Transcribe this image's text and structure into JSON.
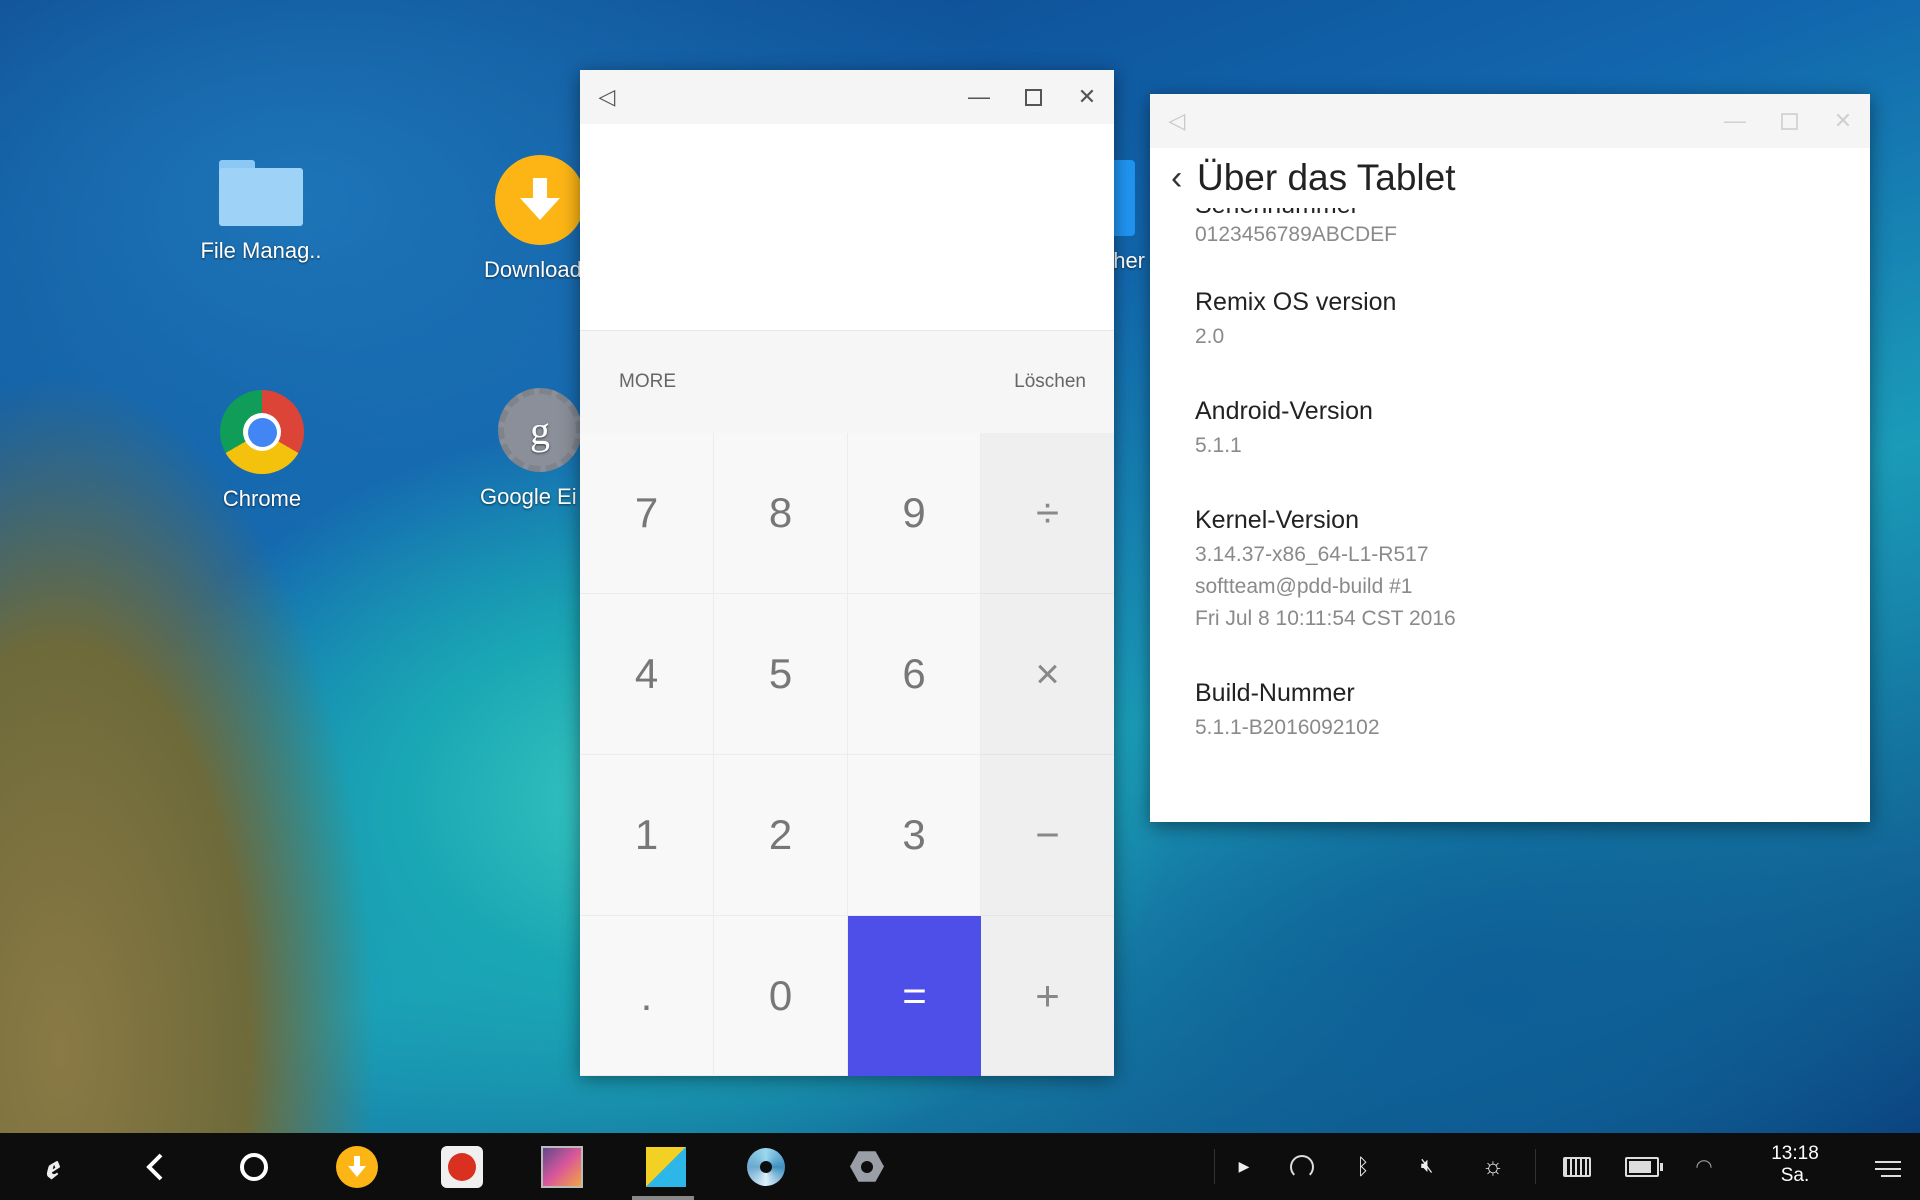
{
  "desktop": {
    "icons": [
      {
        "label": "File Manag.."
      },
      {
        "label": "Download"
      },
      {
        "label": "Chrome"
      },
      {
        "label": "Google Ei"
      },
      {
        "label": "her"
      }
    ]
  },
  "calculator": {
    "title_icon": "back-triangle-icon",
    "display": "",
    "more_label": "MORE",
    "clear_label": "Löschen",
    "keys": {
      "k7": "7",
      "k8": "8",
      "k9": "9",
      "div": "÷",
      "k4": "4",
      "k5": "5",
      "k6": "6",
      "mul": "×",
      "k1": "1",
      "k2": "2",
      "k3": "3",
      "sub": "−",
      "dot": ".",
      "k0": "0",
      "eq": "=",
      "add": "+"
    },
    "colors": {
      "equals": "#4e4ee8"
    }
  },
  "settings": {
    "title": "Über das Tablet",
    "partial_label": "Seriennummer",
    "items": [
      {
        "label": "",
        "value": "0123456789ABCDEF"
      },
      {
        "label": "Remix OS version",
        "value": "2.0"
      },
      {
        "label": "Android-Version",
        "value": "5.1.1"
      },
      {
        "label": "Kernel-Version",
        "value_lines": [
          "3.14.37-x86_64-L1-R517",
          "softteam@pdd-build #1",
          "Fri Jul 8 10:11:54 CST 2016"
        ]
      },
      {
        "label": "Build-Nummer",
        "value": "5.1.1-B2016092102"
      }
    ]
  },
  "taskbar": {
    "time": "13:18",
    "day": "Sa."
  }
}
